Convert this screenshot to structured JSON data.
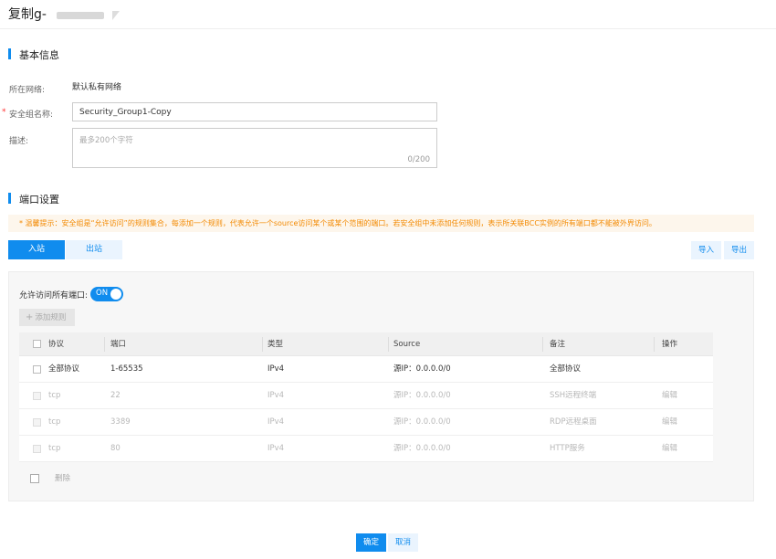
{
  "header": {
    "title": "复制g-"
  },
  "basic": {
    "section_title": "基本信息",
    "network_label": "所在网络:",
    "network_value": "默认私有网络",
    "name_label": "安全组名称:",
    "name_value": "Security_Group1-Copy",
    "desc_label": "描述:",
    "desc_placeholder": "最多200个字符",
    "desc_count": "0/200"
  },
  "ports": {
    "section_title": "端口设置",
    "tip": "* 温馨提示：安全组是“允许访问”的规则集合，每添加一个规则，代表允许一个source访问某个或某个范围的端口。若安全组中未添加任何规则，表示所关联BCC实例的所有端口都不能被外界访问。",
    "tabs": [
      {
        "label": "入站"
      },
      {
        "label": "出站"
      }
    ],
    "import_label": "导入",
    "export_label": "导出",
    "allow_all_label": "允许访问所有端口:",
    "toggle_text": "ON",
    "add_rule_label": "添加规则",
    "columns": {
      "protocol": "协议",
      "port": "端口",
      "type": "类型",
      "source": "Source",
      "remark": "备注",
      "action": "操作"
    },
    "rows": [
      {
        "protocol": "全部协议",
        "port": "1-65535",
        "type": "IPv4",
        "source": "源IP：0.0.0.0/0",
        "remark": "全部协议",
        "action": ""
      },
      {
        "protocol": "tcp",
        "port": "22",
        "type": "IPv4",
        "source": "源IP：0.0.0.0/0",
        "remark": "SSH远程终端",
        "action": "编辑"
      },
      {
        "protocol": "tcp",
        "port": "3389",
        "type": "IPv4",
        "source": "源IP：0.0.0.0/0",
        "remark": "RDP远程桌面",
        "action": "编辑"
      },
      {
        "protocol": "tcp",
        "port": "80",
        "type": "IPv4",
        "source": "源IP：0.0.0.0/0",
        "remark": "HTTP服务",
        "action": "编辑"
      }
    ],
    "delete_label": "删除"
  },
  "footer": {
    "confirm_label": "确定",
    "cancel_label": "取消"
  },
  "colors": {
    "accent": "#108cee",
    "warning": "#f38900",
    "tip_bg": "#fdf6ec"
  }
}
